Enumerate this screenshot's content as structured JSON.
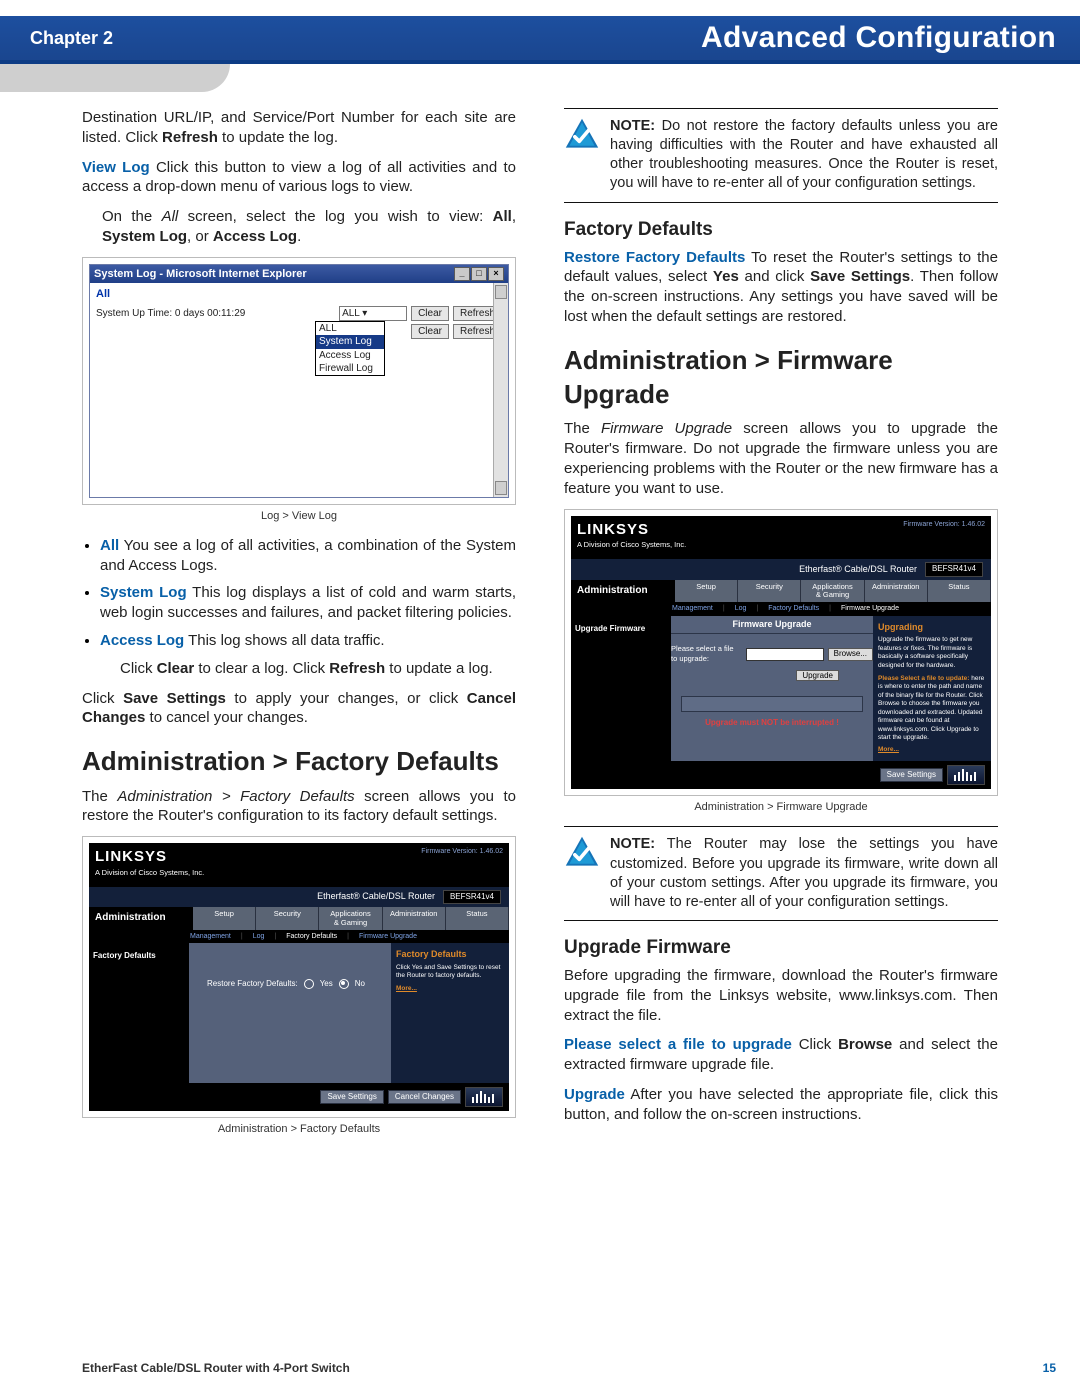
{
  "header": {
    "chapter": "Chapter 2",
    "title": "Advanced Configuration"
  },
  "left": {
    "p1_pre": "Destination URL/IP, and Service/Port Number for each site are listed. Click ",
    "p1_b1": "Refresh",
    "p1_post": " to update the log.",
    "viewlog_lead": "View Log",
    "viewlog_rest": "  Click this button to view a log of all activities and to access a drop-down menu of various logs to view.",
    "onall_pre": "On the ",
    "onall_all_i": "All",
    "onall_mid": " screen, select the log you wish to view: ",
    "onall_b1": "All",
    "onall_sep1": ", ",
    "onall_b2": "System Log",
    "onall_sep2": ", or ",
    "onall_b3": "Access Log",
    "onall_end": ".",
    "syslog": {
      "title": "System Log - Microsoft Internet Explorer",
      "all": "All",
      "uptime": "System Up Time: 0 days 00:11:29",
      "select": "ALL",
      "clear": "Clear",
      "refresh": "Refresh",
      "dd1": "ALL",
      "dd2": "System Log",
      "dd3": "Access Log",
      "dd4": "Firewall Log"
    },
    "caption1": "Log > View Log",
    "li_all_lead": "All",
    "li_all_rest": "  You see a log of all activities, a combination of the System and Access Logs.",
    "li_sys_lead": "System Log",
    "li_sys_rest": "  This log displays a list of cold and warm starts, web login successes and failures, and packet filtering policies.",
    "li_acc_lead": "Access Log",
    "li_acc_rest": "  This log shows all data traffic.",
    "clear_pre": "Click ",
    "clear_b1": "Clear",
    "clear_mid": " to clear a log. Click ",
    "clear_b2": "Refresh",
    "clear_post": " to update a log.",
    "save_pre": "Click ",
    "save_b1": "Save Settings",
    "save_mid": " to apply your changes, or click ",
    "save_b2": "Cancel Changes",
    "save_post": " to cancel your changes.",
    "h_factory": "Administration > Factory Defaults",
    "fd_desc_pre": "The ",
    "fd_desc_i": "Administration > Factory Defaults",
    "fd_desc_post": " screen allows you to restore the Router's configuration to its factory default settings.",
    "linksys": {
      "logo": "LINKSYS",
      "logosub": "A Division of Cisco Systems, Inc.",
      "fw": "Firmware Version: 1.46.02",
      "model_label": "Etherfast® Cable/DSL Router",
      "model_code": "BEFSR41v4",
      "section": "Administration",
      "tabs": [
        "Setup",
        "Security",
        "Applications\n& Gaming",
        "Administration",
        "Status"
      ],
      "subtabs": [
        "Management",
        "Log",
        "Factory Defaults",
        "Firmware Upgrade"
      ],
      "side_item": "Factory Defaults",
      "restore_label": "Restore Factory Defaults:",
      "yes": "Yes",
      "no": "No",
      "right_title": "Factory Defaults",
      "right_text": "Click Yes and Save Settings to reset the Router to factory defaults.",
      "more": "More...",
      "save_btn": "Save Settings",
      "cancel_btn": "Cancel Changes"
    },
    "caption2": "Administration > Factory Defaults"
  },
  "right": {
    "note1_lead": "NOTE:",
    "note1_text": " Do not restore the factory defaults unless you are having difficulties with the Router and have exhausted all other troubleshooting measures. Once the Router is reset, you will have to re-enter all of your configuration settings.",
    "h_fd": "Factory Defaults",
    "rfd_lead": "Restore Factory Defaults",
    "rfd_rest_pre": "  To reset the Router's settings to the default values, select ",
    "rfd_b1": "Yes",
    "rfd_mid": " and click ",
    "rfd_b2": "Save Settings",
    "rfd_post": ". Then follow the on-screen instructions. Any settings you have saved will be lost when the default settings are restored.",
    "h_fw": "Administration > Firmware Upgrade",
    "fw_desc_pre": "The ",
    "fw_desc_i": "Firmware Upgrade",
    "fw_desc_post": " screen allows you to upgrade the Router's firmware. Do not upgrade the firmware unless you are experiencing problems with the Router or the new firmware has a feature you want to use.",
    "linksys": {
      "logo": "LINKSYS",
      "logosub": "A Division of Cisco Systems, Inc.",
      "fw": "Firmware Version: 1.46.02",
      "model_label": "Etherfast® Cable/DSL Router",
      "model_code": "BEFSR41v4",
      "section": "Administration",
      "tabs": [
        "Setup",
        "Security",
        "Applications\n& Gaming",
        "Administration",
        "Status"
      ],
      "subtabs": [
        "Management",
        "Log",
        "Factory Defaults",
        "Firmware Upgrade"
      ],
      "side_item": "Upgrade Firmware",
      "center_title": "Firmware Upgrade",
      "file_label": "Please select a file to upgrade:",
      "browse": "Browse...",
      "upgrade": "Upgrade",
      "warning": "Upgrade must NOT be interrupted !",
      "right_title": "Upgrading",
      "right_p1": "Upgrade the firmware to get new features or fixes. The firmware is basically a software specifically designed for the hardware.",
      "right_p2_lead": "Please Select a file to update:",
      "right_p2": " here is where to enter the path and name of the binary file for the Router. Click Browse to choose the firmware you downloaded and extracted. Updated firmware can be found at www.linksys.com. Click Upgrade to start the upgrade.",
      "more": "More...",
      "save_btn": "Save Settings"
    },
    "caption3": "Administration > Firmware Upgrade",
    "note2_lead": "NOTE:",
    "note2_text": " The Router may lose the settings you have customized. Before you upgrade its firmware, write down all of your custom settings. After you upgrade its firmware, you will have to re-enter all of your configuration settings.",
    "h_uf": "Upgrade Firmware",
    "uf_p1": "Before upgrading the firmware, download the Router's firmware upgrade file from the Linksys website, www.linksys.com. Then extract the file.",
    "uf_select_lead": "Please select a file to upgrade",
    "uf_select_rest_pre": "  Click ",
    "uf_select_b": "Browse",
    "uf_select_rest_post": " and select the extracted firmware upgrade file.",
    "uf_upgrade_lead": "Upgrade",
    "uf_upgrade_rest": "  After you have selected the appropriate file, click this button, and follow the on-screen instructions."
  },
  "footer": {
    "left": "EtherFast Cable/DSL Router with 4-Port Switch",
    "right": "15"
  }
}
